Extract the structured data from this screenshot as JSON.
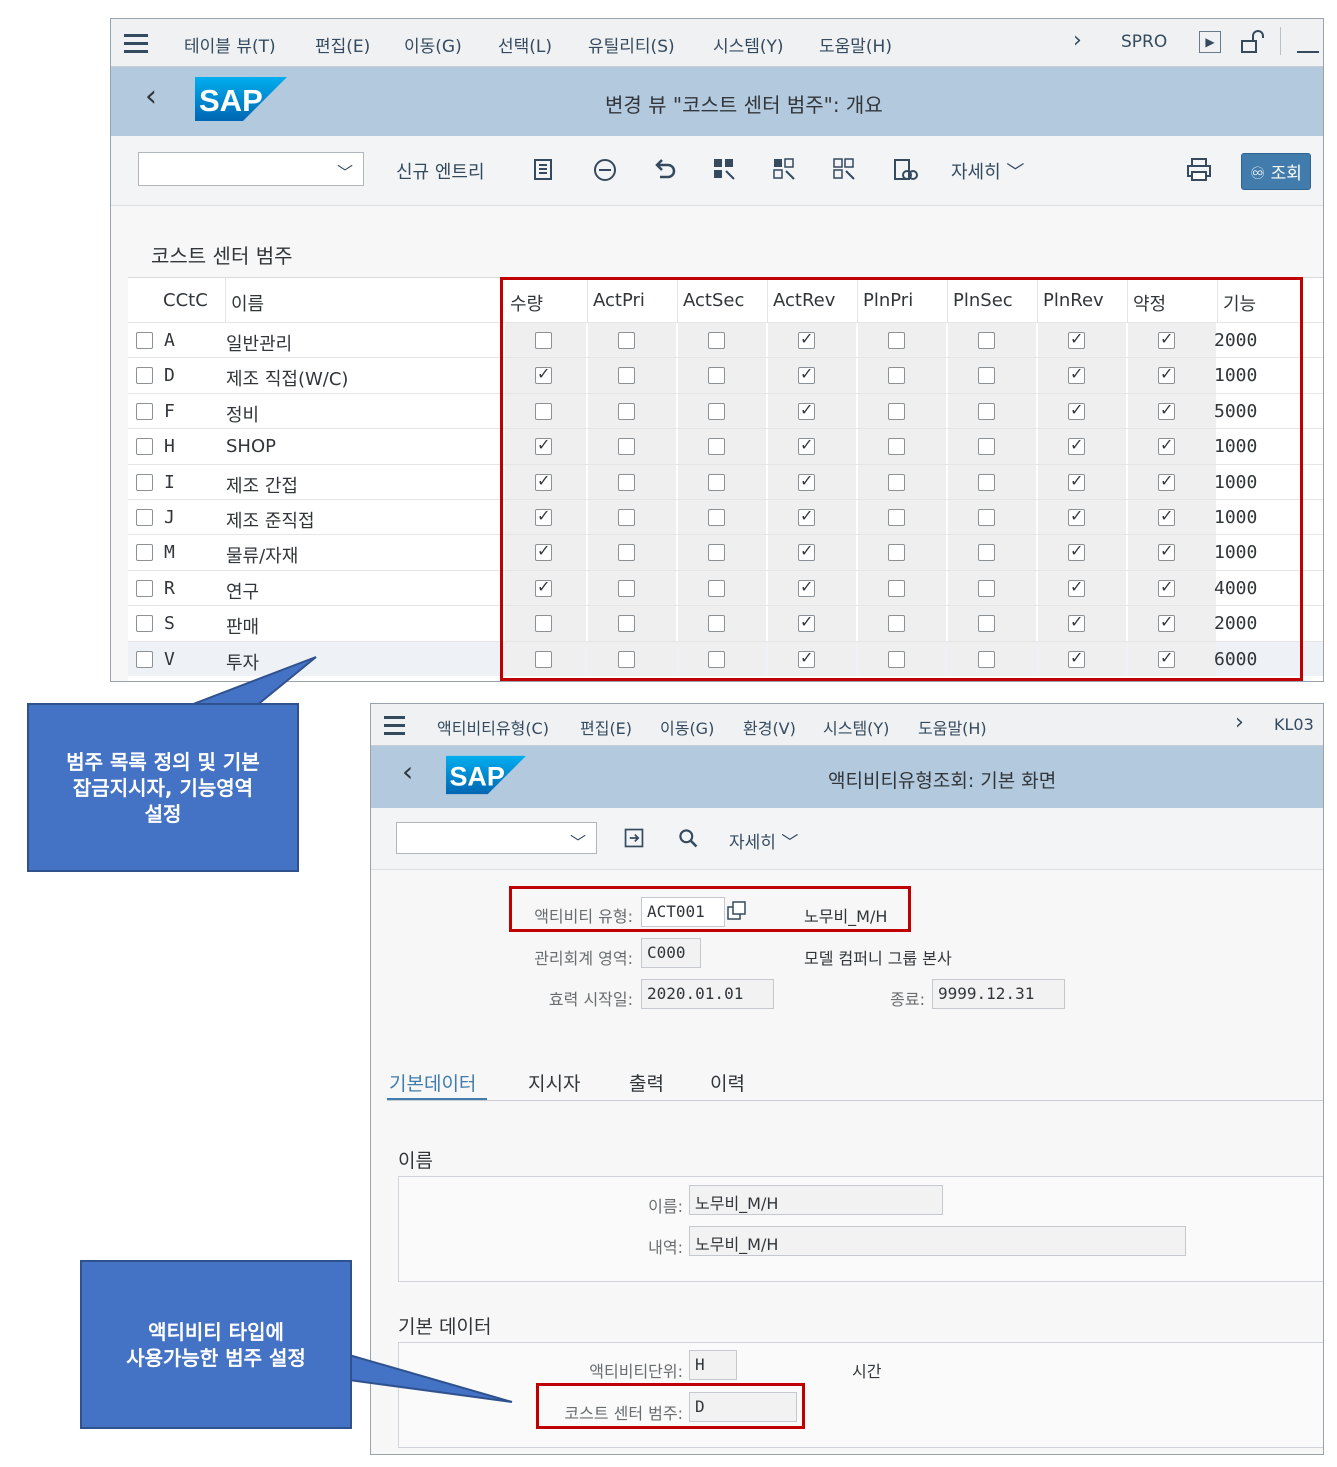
{
  "window1": {
    "menu": [
      "테이블 뷰(T)",
      "편집(E)",
      "이동(G)",
      "선택(L)",
      "유틸리티(S)",
      "시스템(Y)",
      "도움말(H)"
    ],
    "tcode": "SPRO",
    "title": "변경 뷰 \"코스트 센터 범주\": 개요",
    "toolbar": {
      "new_entry": "신규 엔트리",
      "more": "자세히",
      "display": "조회"
    },
    "section_title": "코스트 센터 범주",
    "columns": [
      "CCtC",
      "이름",
      "수량",
      "ActPri",
      "ActSec",
      "ActRev",
      "PlnPri",
      "PlnSec",
      "PlnRev",
      "약정",
      "기능"
    ],
    "rows": [
      {
        "code": "A",
        "name": "일반관리",
        "flags": [
          false,
          false,
          false,
          true,
          false,
          false,
          true,
          true
        ],
        "func": "2000"
      },
      {
        "code": "D",
        "name": "제조 직접(W/C)",
        "flags": [
          true,
          false,
          false,
          true,
          false,
          false,
          true,
          true
        ],
        "func": "1000"
      },
      {
        "code": "F",
        "name": "정비",
        "flags": [
          false,
          false,
          false,
          true,
          false,
          false,
          true,
          true
        ],
        "func": "5000"
      },
      {
        "code": "H",
        "name": "SHOP",
        "flags": [
          true,
          false,
          false,
          true,
          false,
          false,
          true,
          true
        ],
        "func": "1000"
      },
      {
        "code": "I",
        "name": "제조 간접",
        "flags": [
          true,
          false,
          false,
          true,
          false,
          false,
          true,
          true
        ],
        "func": "1000"
      },
      {
        "code": "J",
        "name": "제조 준직접",
        "flags": [
          true,
          false,
          false,
          true,
          false,
          false,
          true,
          true
        ],
        "func": "1000"
      },
      {
        "code": "M",
        "name": "물류/자재",
        "flags": [
          true,
          false,
          false,
          true,
          false,
          false,
          true,
          true
        ],
        "func": "1000"
      },
      {
        "code": "R",
        "name": "연구",
        "flags": [
          true,
          false,
          false,
          true,
          false,
          false,
          true,
          true
        ],
        "func": "4000"
      },
      {
        "code": "S",
        "name": "판매",
        "flags": [
          false,
          false,
          false,
          true,
          false,
          false,
          true,
          true
        ],
        "func": "2000"
      },
      {
        "code": "V",
        "name": "투자",
        "flags": [
          false,
          false,
          false,
          true,
          false,
          false,
          true,
          true
        ],
        "func": "6000"
      }
    ]
  },
  "window2": {
    "menu": [
      "액티비티유형(C)",
      "편집(E)",
      "이동(G)",
      "환경(V)",
      "시스템(Y)",
      "도움말(H)"
    ],
    "tcode": "KL03",
    "title": "액티비티유형조회: 기본 화면",
    "toolbar": {
      "more": "자세히"
    },
    "fields": {
      "activity_type_label": "액티비티 유형:",
      "activity_type": "ACT001",
      "activity_type_desc": "노무비_M/H",
      "co_area_label": "관리회계 영역:",
      "co_area": "C000",
      "co_area_desc": "모델 컴퍼니 그룹 본사",
      "valid_from_label": "효력 시작일:",
      "valid_from": "2020.01.01",
      "valid_to_label": "종료:",
      "valid_to": "9999.12.31"
    },
    "tabs": [
      "기본데이터",
      "지시자",
      "출력",
      "이력"
    ],
    "name_group": {
      "title": "이름",
      "name_label": "이름:",
      "name": "노무비_M/H",
      "desc_label": "내역:",
      "desc": "노무비_M/H"
    },
    "basic_group": {
      "title": "기본 데이터",
      "unit_label": "액티비티단위:",
      "unit": "H",
      "unit_desc": "시간",
      "cctc_label": "코스트 센터 범주:",
      "cctc": "D"
    }
  },
  "callouts": {
    "first": [
      "범주 목록 정의 및 기본",
      "잡금지시자, 기능영역",
      "설정"
    ],
    "second": [
      "액티비티 타입에",
      "사용가능한 범주 설정"
    ]
  }
}
